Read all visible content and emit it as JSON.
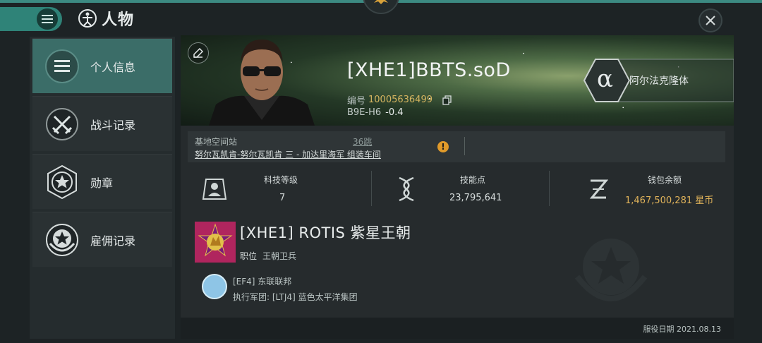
{
  "header": {
    "title": "人物",
    "menu_icon": "hamburger-icon",
    "title_icon": "vitruvian-man-icon",
    "close_icon": "close-icon"
  },
  "sidebar": {
    "items": [
      {
        "label": "个人信息",
        "icon": "list-icon",
        "active": true
      },
      {
        "label": "战斗记录",
        "icon": "crossed-swords-icon",
        "active": false
      },
      {
        "label": "勋章",
        "icon": "star-hexagon-icon",
        "active": false
      },
      {
        "label": "雇佣记录",
        "icon": "star-wreath-icon",
        "active": false
      }
    ]
  },
  "character": {
    "name": "[XHE1]BBTS.soD",
    "id_label": "编号",
    "id_value": "10005636499",
    "security_system": "B9E-H6",
    "security_status": "-0.4",
    "clone_symbol": "α",
    "clone_type": "阿尔法克隆体"
  },
  "station": {
    "label": "基地空间站",
    "jumps": "36跳",
    "name": "努尔瓦凯肯-努尔瓦凯肯 三 - 加达里海军 组装车间",
    "warning_symbol": "!"
  },
  "stats": {
    "tech_label": "科技等级",
    "tech_value": "7",
    "skill_label": "技能点",
    "skill_value": "23,795,641",
    "wallet_label": "钱包余额",
    "wallet_value": "1,467,500,281 星币"
  },
  "corporation": {
    "name": "[XHE1] ROTIS 紫星王朝",
    "role_label": "职位",
    "role_value": "王朝卫兵"
  },
  "alliance": {
    "name": "[EF4] 东联联邦",
    "exec_corp": "执行军团: [LTJ4] 蓝色太平洋集团"
  },
  "footer": {
    "service_date": "服役日期 2021.08.13"
  },
  "colors": {
    "accent": "#2f8378",
    "active_sidebar": "#3b6d68",
    "gold": "#e0b35a",
    "corp_logo": "#b0255e"
  }
}
